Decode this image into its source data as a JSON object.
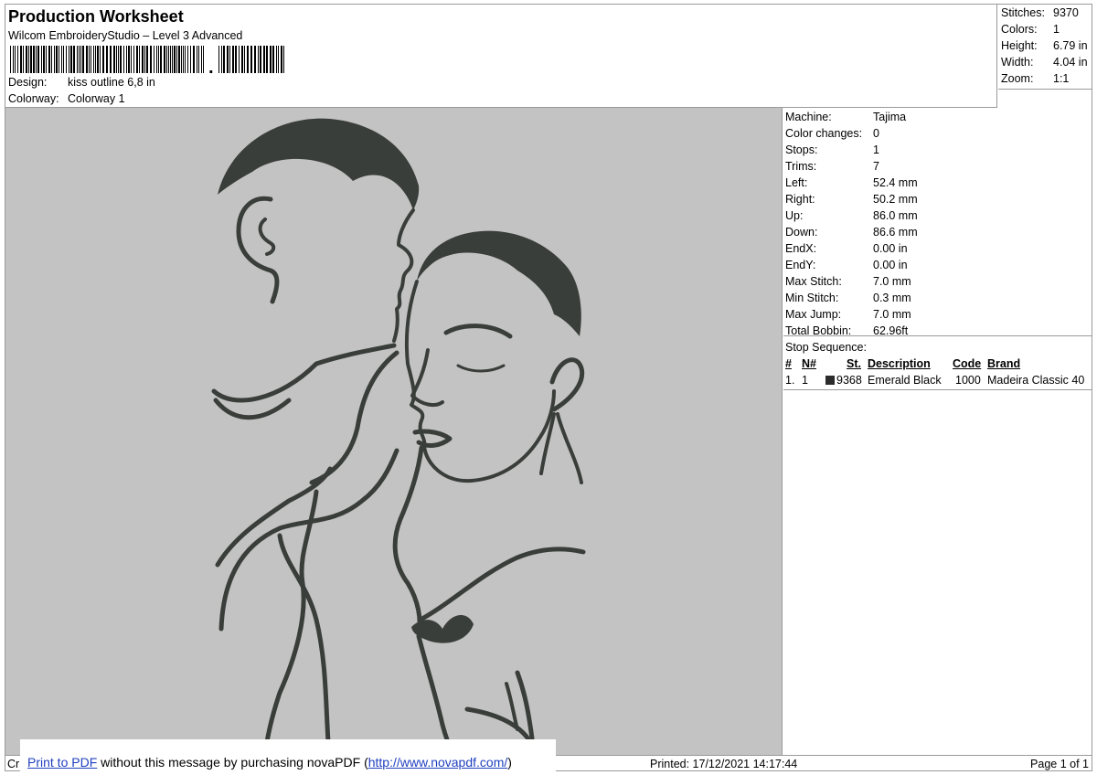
{
  "header": {
    "title": "Production Worksheet",
    "subtitle": "Wilcom EmbroideryStudio – Level 3 Advanced",
    "barcode_suffix": ",",
    "design_label": "Design:",
    "design_value": "kiss outline 6,8 in",
    "colorway_label": "Colorway:",
    "colorway_value": "Colorway 1"
  },
  "summary": [
    {
      "label": "Stitches:",
      "value": "9370"
    },
    {
      "label": "Colors:",
      "value": "1"
    },
    {
      "label": "Height:",
      "value": "6.79 in"
    },
    {
      "label": "Width:",
      "value": "4.04 in"
    },
    {
      "label": "Zoom:",
      "value": "1:1"
    }
  ],
  "info": [
    {
      "label": "Machine:",
      "value": "Tajima"
    },
    {
      "label": "Color changes:",
      "value": "0"
    },
    {
      "label": "Stops:",
      "value": "1"
    },
    {
      "label": "Trims:",
      "value": "7"
    },
    {
      "label": "Left:",
      "value": "52.4 mm"
    },
    {
      "label": "Right:",
      "value": "50.2 mm"
    },
    {
      "label": "Up:",
      "value": "86.0 mm"
    },
    {
      "label": "Down:",
      "value": "86.6 mm"
    },
    {
      "label": "EndX:",
      "value": "0.00 in"
    },
    {
      "label": "EndY:",
      "value": "0.00 in"
    },
    {
      "label": "Max Stitch:",
      "value": "7.0 mm"
    },
    {
      "label": "Min Stitch:",
      "value": "0.3 mm"
    },
    {
      "label": "Max Jump:",
      "value": "7.0 mm"
    },
    {
      "label": "Total Bobbin:",
      "value": "62.96ft"
    }
  ],
  "stop_sequence": {
    "caption": "Stop Sequence:",
    "headers": {
      "num": "#",
      "n": "N#",
      "st": "St.",
      "desc": "Description",
      "code": "Code",
      "brand": "Brand"
    },
    "rows": [
      {
        "num": "1.",
        "n": "1",
        "st": "9368",
        "desc": "Emerald Black",
        "code": "1000",
        "brand": "Madeira Classic 40",
        "color": "#2b2b2b"
      }
    ]
  },
  "footer": {
    "cr": "Cr",
    "printed": "Printed: 17/12/2021 14:17:44",
    "page": "Page 1 of 1"
  },
  "nova": {
    "link_text": "Print to PDF",
    "middle_text": " without this message by purchasing novaPDF (",
    "url_text": "http://www.novapdf.com/",
    "end_text": ")"
  },
  "colors": {
    "preview_bg": "#c3c3c3",
    "thread": "#3a3e3a"
  }
}
